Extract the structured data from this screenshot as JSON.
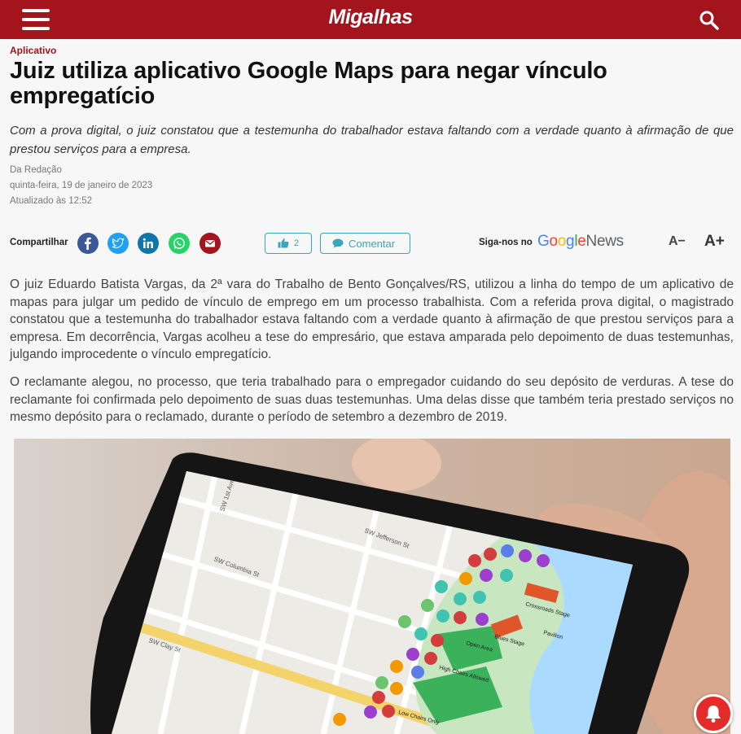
{
  "header": {
    "logo_text": "Migalhas",
    "brand_color": "#a4141d",
    "menu_icon": "hamburger-menu-icon",
    "search_icon": "search-icon"
  },
  "article": {
    "category": "Aplicativo",
    "title": "Juiz utiliza aplicativo Google Maps para negar vínculo empregatício",
    "lead": "Com a prova digital, o juiz constatou que a testemunha do trabalhador estava faltando com a verdade quanto à afirmação de que prestou serviços para a empresa.",
    "author": "Da Redação",
    "date": "quinta-feira, 19 de janeiro de 2023",
    "updated": "Atualizado às 12:52",
    "paragraphs": [
      "O juiz Eduardo Batista Vargas, da 2ª vara do Trabalho de Bento Gonçalves/RS, utilizou a linha do tempo de um aplicativo de mapas para julgar um pedido de vínculo de emprego em um processo trabalhista. Com a referida prova digital, o magistrado constatou que a testemunha do trabalhador estava faltando com a verdade quanto à afirmação de que prestou serviços para a empresa. Em decorrência, Vargas acolheu a tese do empresário, que estava amparada pelo depoimento de duas testemunhas, julgando improcedente o vínculo empregatício.",
      "O reclamante alegou, no processo, que teria trabalhado para o empregador cuidando do seu depósito de verduras. A tese do reclamante foi confirmada pelo depoimento de suas duas testemunhas. Uma delas disse que também teria prestado serviços no mesmo depósito para o reclamado, durante o período de setembro a dezembro de 2019."
    ]
  },
  "share_bar": {
    "share_label": "Compartilhar",
    "networks": [
      {
        "name": "facebook",
        "icon": "facebook-icon",
        "color": "#3b5998"
      },
      {
        "name": "twitter",
        "icon": "twitter-icon",
        "color": "#1da1f2"
      },
      {
        "name": "linkedin",
        "icon": "linkedin-icon",
        "color": "#0e76a8"
      },
      {
        "name": "whatsapp",
        "icon": "whatsapp-icon",
        "color": "#25d366"
      },
      {
        "name": "email",
        "icon": "email-icon",
        "color": "#a4141d"
      }
    ],
    "like_count": "2",
    "comment_label": "Comentar",
    "follow_label": "Siga-nos no",
    "google_news": {
      "google": "Google",
      "news": "News"
    },
    "font_decrease": "A−",
    "font_increase": "A+",
    "accent_color": "#3aa6b9"
  },
  "hero_image": {
    "map_labels": [
      "SW 1st Ave",
      "SW Jefferson St",
      "SW Columbia St",
      "SW Clay St",
      "Crossroads Stage",
      "Blues Stage",
      "Open Area",
      "High Chairs Allowed",
      "Low Chairs Only",
      "Pavilion"
    ]
  },
  "notification_icon": "bell-icon"
}
